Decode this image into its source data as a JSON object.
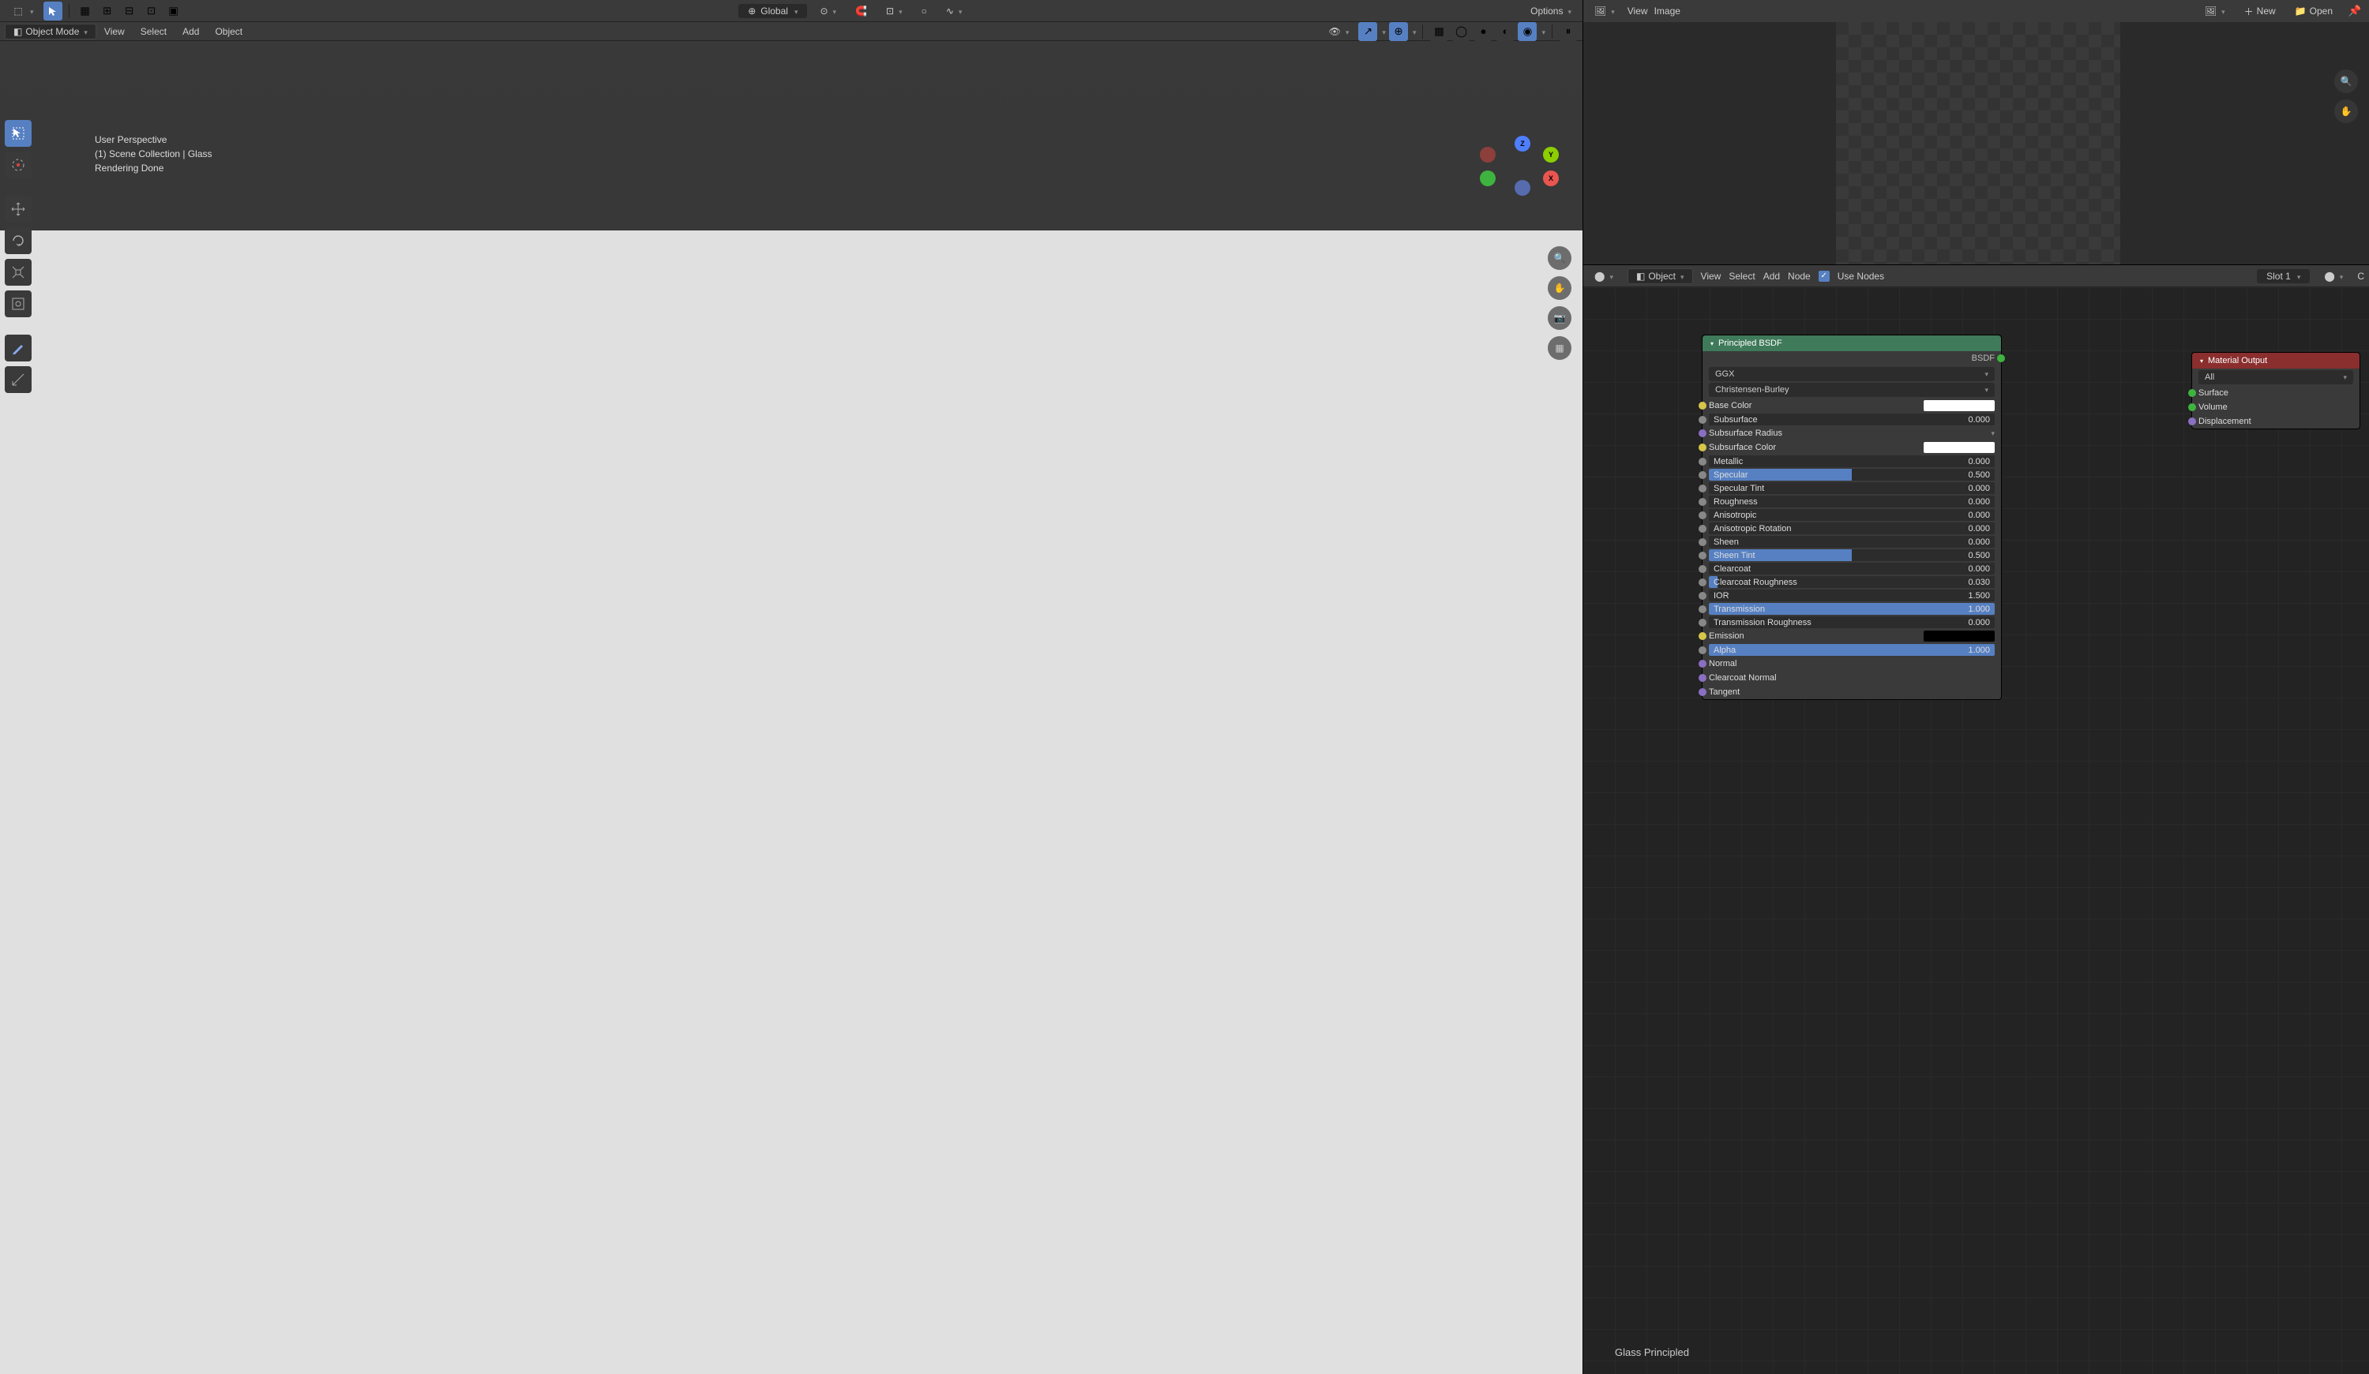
{
  "header": {
    "transform_orientation": "Global",
    "options_label": "Options"
  },
  "mode_bar": {
    "mode_label": "Object Mode",
    "menus": [
      "View",
      "Select",
      "Add",
      "Object"
    ]
  },
  "overlay": {
    "line1": "User Perspective",
    "line2": "(1) Scene Collection | Glass",
    "line3": "Rendering Done"
  },
  "image_editor": {
    "menus": [
      "View",
      "Image"
    ],
    "new_btn": "New",
    "open_btn": "Open"
  },
  "node_editor": {
    "mode_label": "Object",
    "menus": [
      "View",
      "Select",
      "Add",
      "Node"
    ],
    "use_nodes_label": "Use Nodes",
    "slot_label": "Slot 1",
    "material_name": "Glass Principled"
  },
  "bsdf_node": {
    "title": "Principled BSDF",
    "output_bsdf": "BSDF",
    "distribution": "GGX",
    "sss_method": "Christensen-Burley",
    "props": {
      "base_color": "Base Color",
      "subsurface": {
        "label": "Subsurface",
        "val": "0.000",
        "fill": 0
      },
      "subsurface_radius": "Subsurface Radius",
      "subsurface_color": "Subsurface Color",
      "metallic": {
        "label": "Metallic",
        "val": "0.000",
        "fill": 0
      },
      "specular": {
        "label": "Specular",
        "val": "0.500",
        "fill": 50
      },
      "specular_tint": {
        "label": "Specular Tint",
        "val": "0.000",
        "fill": 0
      },
      "roughness": {
        "label": "Roughness",
        "val": "0.000",
        "fill": 0
      },
      "anisotropic": {
        "label": "Anisotropic",
        "val": "0.000",
        "fill": 0
      },
      "anisotropic_rotation": {
        "label": "Anisotropic Rotation",
        "val": "0.000",
        "fill": 0
      },
      "sheen": {
        "label": "Sheen",
        "val": "0.000",
        "fill": 0
      },
      "sheen_tint": {
        "label": "Sheen Tint",
        "val": "0.500",
        "fill": 50
      },
      "clearcoat": {
        "label": "Clearcoat",
        "val": "0.000",
        "fill": 0
      },
      "clearcoat_roughness": {
        "label": "Clearcoat Roughness",
        "val": "0.030",
        "fill": 3
      },
      "ior": {
        "label": "IOR",
        "val": "1.500",
        "fill": 0
      },
      "transmission": {
        "label": "Transmission",
        "val": "1.000",
        "fill": 100
      },
      "transmission_roughness": {
        "label": "Transmission Roughness",
        "val": "0.000",
        "fill": 0
      },
      "emission": "Emission",
      "alpha": {
        "label": "Alpha",
        "val": "1.000",
        "fill": 100
      },
      "normal": "Normal",
      "clearcoat_normal": "Clearcoat Normal",
      "tangent": "Tangent"
    }
  },
  "output_node": {
    "title": "Material Output",
    "target": "All",
    "inputs": [
      "Surface",
      "Volume",
      "Displacement"
    ]
  }
}
